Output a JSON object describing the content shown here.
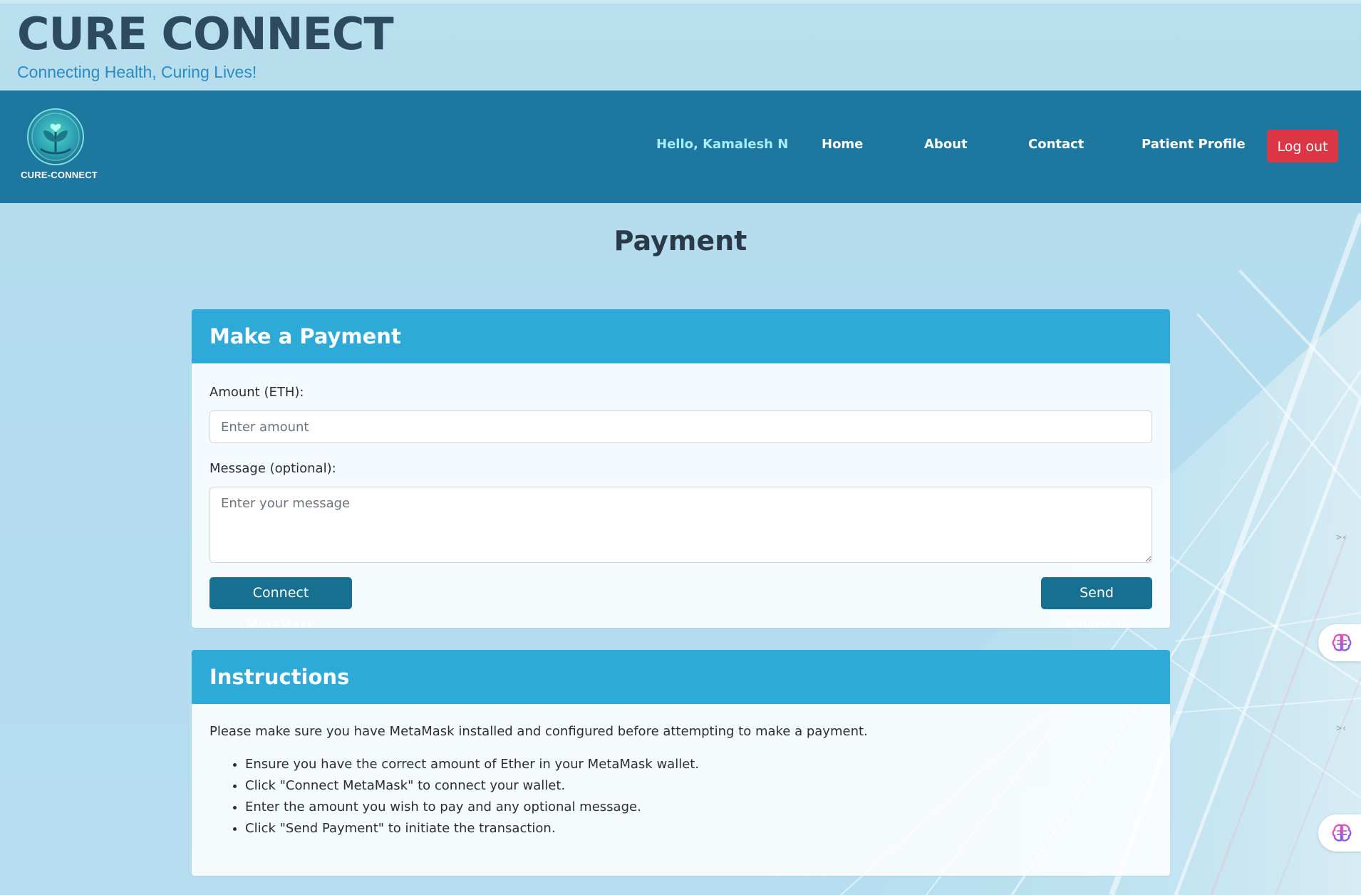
{
  "header": {
    "title": "CURE CONNECT",
    "tagline": "Connecting Health, Curing Lives!"
  },
  "navbar": {
    "logo_text": "CURE-CONNECT",
    "logo_icon": "plant-heart-logo-icon",
    "greeting": "Hello, Kamalesh N",
    "items": [
      {
        "label": "Home"
      },
      {
        "label": "About"
      },
      {
        "label": "Contact"
      },
      {
        "label": "Patient Profile"
      }
    ],
    "logout_label": "Log out"
  },
  "page": {
    "title": "Payment"
  },
  "payment_form": {
    "header": "Make a Payment",
    "amount_label": "Amount (ETH):",
    "amount_placeholder": "Enter amount",
    "amount_value": "",
    "message_label": "Message (optional):",
    "message_placeholder": "Enter your message",
    "message_value": "",
    "connect_button": "Connect MetaMask",
    "send_button": "Send Payment"
  },
  "instructions": {
    "header": "Instructions",
    "intro": "Please make sure you have MetaMask installed and configured before attempting to make a payment.",
    "steps": [
      "Ensure you have the correct amount of Ether in your MetaMask wallet.",
      "Click \"Connect MetaMask\" to connect your wallet.",
      "Enter the amount you wish to pay and any optional message.",
      "Click \"Send Payment\" to initiate the transaction."
    ]
  },
  "side_widgets": {
    "icon": "brain-icon",
    "close_icon": "close-icon"
  },
  "colors": {
    "navbar": "#1d779e",
    "card_header": "#2eaad9",
    "primary_button": "#17708f",
    "logout_button": "#dc3545",
    "greeting": "#a8ecff",
    "tagline": "#2a8cc4"
  }
}
